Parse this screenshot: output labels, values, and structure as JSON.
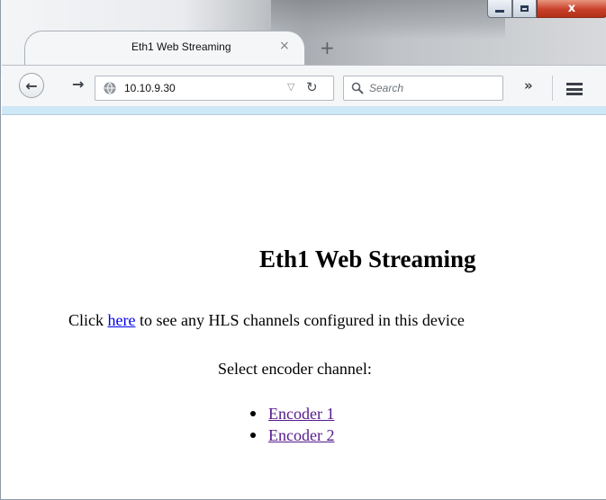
{
  "browser": {
    "tab_title": "Eth1 Web Streaming",
    "tab_close": "×",
    "new_tab": "+",
    "url": "10.10.9.30",
    "search_placeholder": "Search",
    "overflow": "»",
    "window_close": "x"
  },
  "page": {
    "heading": "Eth1 Web Streaming",
    "hls_prefix": "Click ",
    "hls_link": "here",
    "hls_suffix": " to see any HLS channels configured in this device",
    "select_label": "Select encoder channel:",
    "encoders": [
      {
        "label": "Encoder 1"
      },
      {
        "label": "Encoder 2"
      }
    ]
  },
  "colors": {
    "link": "#0000ee",
    "visited_link": "#551a8b",
    "close_button": "#c8402a",
    "toolbar_accent": "#cfe8f7"
  },
  "icons": [
    "back-arrow-icon",
    "forward-arrow-icon",
    "globe-icon",
    "dropdown-triangle-icon",
    "reload-icon",
    "search-icon",
    "overflow-chevron-icon",
    "hamburger-menu-icon",
    "minimize-icon",
    "maximize-icon",
    "close-icon"
  ]
}
